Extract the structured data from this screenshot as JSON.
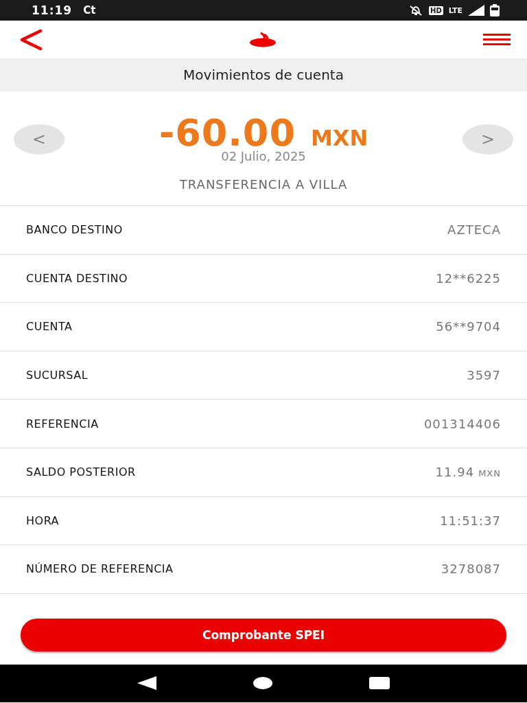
{
  "status_bar": {
    "time": "11:19",
    "carrier": "Ct",
    "hd": "HD",
    "network": "LTE"
  },
  "header": {
    "title": "Movimientos de cuenta"
  },
  "transaction": {
    "amount": "-60.00",
    "currency": "MXN",
    "date": "02 Julio, 2025",
    "description": "TRANSFERENCIA A VILLA",
    "prev": "<",
    "next": ">"
  },
  "details": [
    {
      "label": "BANCO DESTINO",
      "value": "AZTECA"
    },
    {
      "label": "CUENTA DESTINO",
      "value": "12**6225"
    },
    {
      "label": "CUENTA",
      "value": "56**9704"
    },
    {
      "label": "SUCURSAL",
      "value": "3597"
    },
    {
      "label": "REFERENCIA",
      "value": "001314406"
    },
    {
      "label": "SALDO POSTERIOR",
      "value": "11.94",
      "unit": "MXN"
    },
    {
      "label": "HORA",
      "value": "11:51:37"
    },
    {
      "label": "NÚMERO DE REFERENCIA",
      "value": "3278087"
    }
  ],
  "button": {
    "label": "Comprobante SPEI"
  }
}
